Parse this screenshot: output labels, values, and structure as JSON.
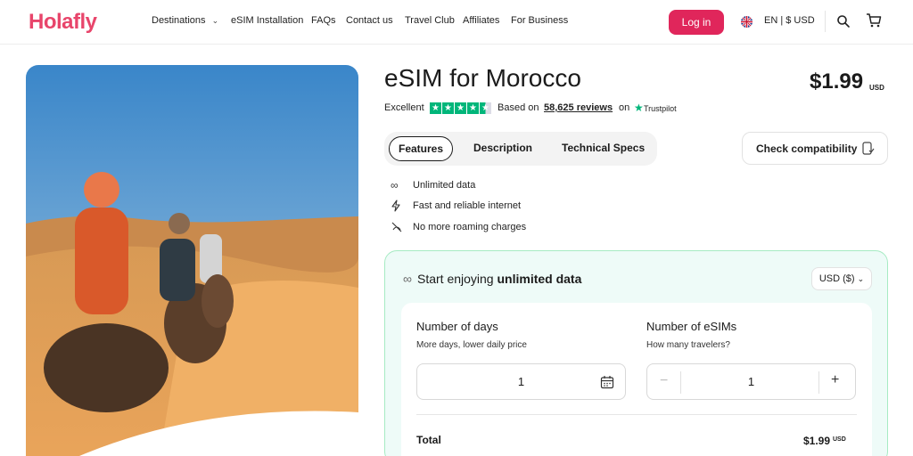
{
  "header": {
    "logo": "Holafly",
    "nav": [
      {
        "label": "Destinations",
        "has_dropdown": true
      },
      {
        "label": "eSIM Installation"
      },
      {
        "label": "FAQs"
      },
      {
        "label": "Contact us"
      },
      {
        "label": "Travel Club"
      },
      {
        "label": "Affiliates"
      },
      {
        "label": "For Business"
      }
    ],
    "login_label": "Log in",
    "language": "EN | $ USD",
    "icons": [
      "uk-flag-icon",
      "search-icon",
      "cart-icon"
    ],
    "brand_color": "#e0265b"
  },
  "product": {
    "title": "eSIM for Morocco",
    "price": "$1.99",
    "price_currency": "USD",
    "rating": {
      "label": "Excellent",
      "stars": 4.5,
      "based_on": "Based on",
      "reviews": "58,625 reviews",
      "on": "on",
      "provider": "Trustpilot"
    }
  },
  "tabs": [
    {
      "label": "Features",
      "active": true
    },
    {
      "label": "Description",
      "active": false
    },
    {
      "label": "Technical Specs",
      "active": false
    }
  ],
  "check_compatibility": "Check compatibility",
  "features": [
    {
      "icon": "infinity-icon",
      "text": "Unlimited data"
    },
    {
      "icon": "lightning-icon",
      "text": "Fast and reliable internet"
    },
    {
      "icon": "no-roaming-icon",
      "text": "No more roaming charges"
    }
  ],
  "plan": {
    "heading_prefix": "Start enjoying",
    "heading_bold": "unlimited data",
    "currency_select": "USD ($)",
    "days": {
      "label": "Number of days",
      "hint": "More days, lower daily price",
      "value": "1"
    },
    "esims": {
      "label": "Number of eSIMs",
      "hint": "How many travelers?",
      "value": "1",
      "minus": "−",
      "plus": "+"
    },
    "total_label": "Total",
    "total_value": "$1.99",
    "total_currency": "USD"
  }
}
